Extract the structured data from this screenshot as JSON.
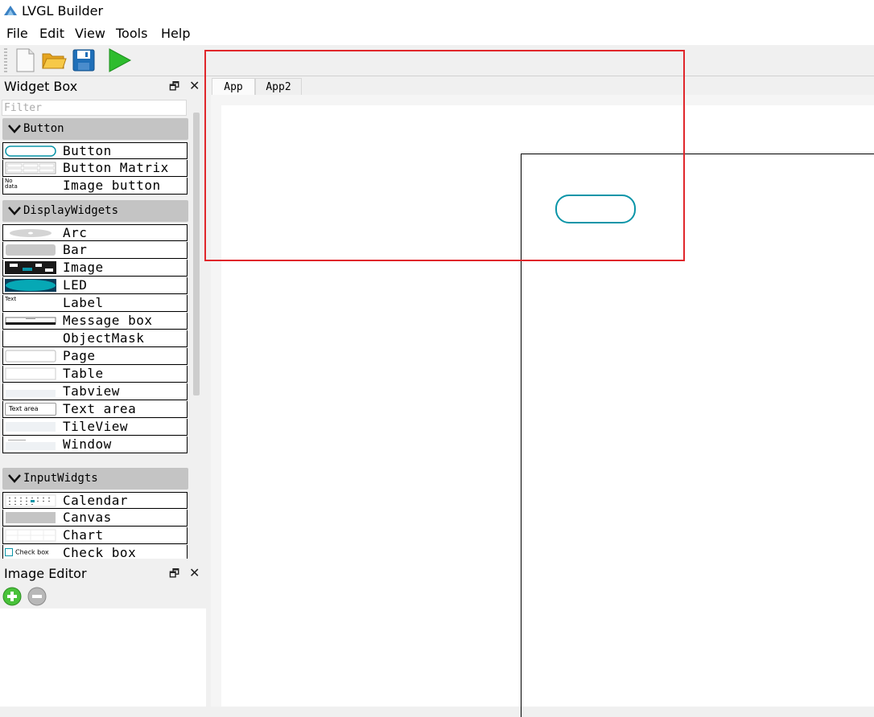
{
  "window": {
    "title": "LVGL Builder"
  },
  "menu": [
    "File",
    "Edit",
    "View",
    "Tools",
    "Help"
  ],
  "toolbar": {
    "icons": [
      "new-file-icon",
      "open-folder-icon",
      "save-icon",
      "run-icon"
    ]
  },
  "widget_box": {
    "title": "Widget Box",
    "filter_placeholder": "Filter",
    "categories": [
      {
        "name": "Button",
        "items": [
          "Button",
          "Button Matrix",
          "Image button"
        ]
      },
      {
        "name": "DisplayWidgets",
        "items": [
          "Arc",
          "Bar",
          "Image",
          "LED",
          "Label",
          "Message box",
          "ObjectMask",
          "Page",
          "Table",
          "Tabview",
          "Text area",
          "TileView",
          "Window"
        ]
      },
      {
        "name": "InputWidgts",
        "items": [
          "Calendar",
          "Canvas",
          "Chart",
          "Check box"
        ]
      }
    ],
    "thumb_texts": {
      "image_button": "No\ndata",
      "label": "Text",
      "text_area": "Text area",
      "check_box": "Check box"
    }
  },
  "image_editor": {
    "title": "Image Editor"
  },
  "tabs": [
    "App",
    "App2"
  ],
  "colors": {
    "accent": "#0a95a8",
    "highlight": "#e0262b"
  }
}
